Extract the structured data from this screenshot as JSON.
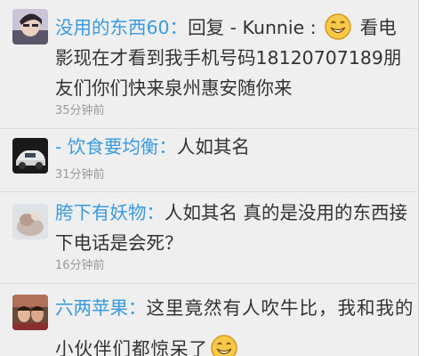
{
  "comments": [
    {
      "username": "没用的东西60",
      "separator": "：",
      "text_before": "回复 - Kunnie : ",
      "text_after": " 看电影现在才看到我手机号码18120707189朋友们你们快来泉州惠安随你来",
      "time": "35分钟前",
      "emoji": "smile-emoji"
    },
    {
      "username": "- 饮食要均衡",
      "separator": "：",
      "text": "人如其名",
      "time": "31分钟前"
    },
    {
      "username": "胯下有妖物",
      "separator": "：",
      "text": "人如其名 真的是没用的东西接下电话是会死？",
      "time": "16分钟前"
    },
    {
      "username": "六两苹果",
      "separator": "：",
      "text_before": "这里竟然有人吹牛比，我和我的小伙伴们都惊呆了",
      "time": "",
      "emoji": "smile-emoji"
    }
  ],
  "colors": {
    "username": "#3a9be0",
    "text": "#333333",
    "time": "#9a9a9a",
    "background": "#efefef"
  }
}
